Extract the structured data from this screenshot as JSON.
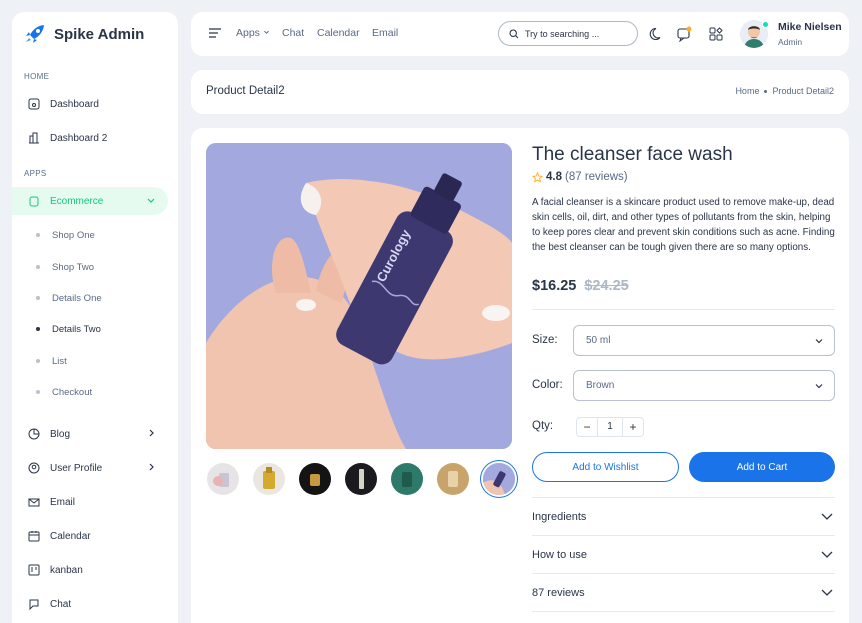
{
  "brand": {
    "name": "Spike Admin"
  },
  "sidebar": {
    "caption_home": "HOME",
    "caption_apps": "APPS",
    "items": [
      {
        "label": "Dashboard"
      },
      {
        "label": "Dashboard 2"
      },
      {
        "label": "Ecommerce"
      },
      {
        "label": "Blog"
      },
      {
        "label": "User Profile"
      },
      {
        "label": "Email"
      },
      {
        "label": "Calendar"
      },
      {
        "label": "kanban"
      },
      {
        "label": "Chat"
      }
    ],
    "ecommerce_sub": [
      {
        "label": "Shop One"
      },
      {
        "label": "Shop Two"
      },
      {
        "label": "Details One"
      },
      {
        "label": "Details Two"
      },
      {
        "label": "List"
      },
      {
        "label": "Checkout"
      }
    ]
  },
  "topbar": {
    "links": [
      "Apps",
      "Chat",
      "Calendar",
      "Email"
    ],
    "search_placeholder": "Try to searching ...",
    "user_name": "Mike Nielsen",
    "user_role": "Admin"
  },
  "titlebar": {
    "title": "Product Detail2",
    "breadcrumb": [
      "Home",
      "Product Detail2"
    ]
  },
  "product": {
    "name": "The cleanser face wash",
    "rating": "4.8",
    "reviews": "(87 reviews)",
    "description": "A facial cleanser is a skincare product used to remove make-up, dead skin cells, oil, dirt, and other types of pollutants from the skin, helping to keep pores clear and prevent skin conditions such as acne. Finding the best cleanser can be tough given there are so many options.",
    "price": "$16.25",
    "old_price": "$24.25",
    "bottle_text": "Curology",
    "size_label": "Size:",
    "size_value": "50 ml",
    "color_label": "Color:",
    "color_value": "Brown",
    "qty_label": "Qty:",
    "qty_value": "1",
    "wishlist_label": "Add to Wishlist",
    "cart_label": "Add to Cart",
    "accordions": [
      "Ingredients",
      "How to use",
      "87 reviews"
    ]
  },
  "colors": {
    "primary": "#1a73e8",
    "accent_green": "#13c77c",
    "hero_bg": "#a3a9de"
  }
}
